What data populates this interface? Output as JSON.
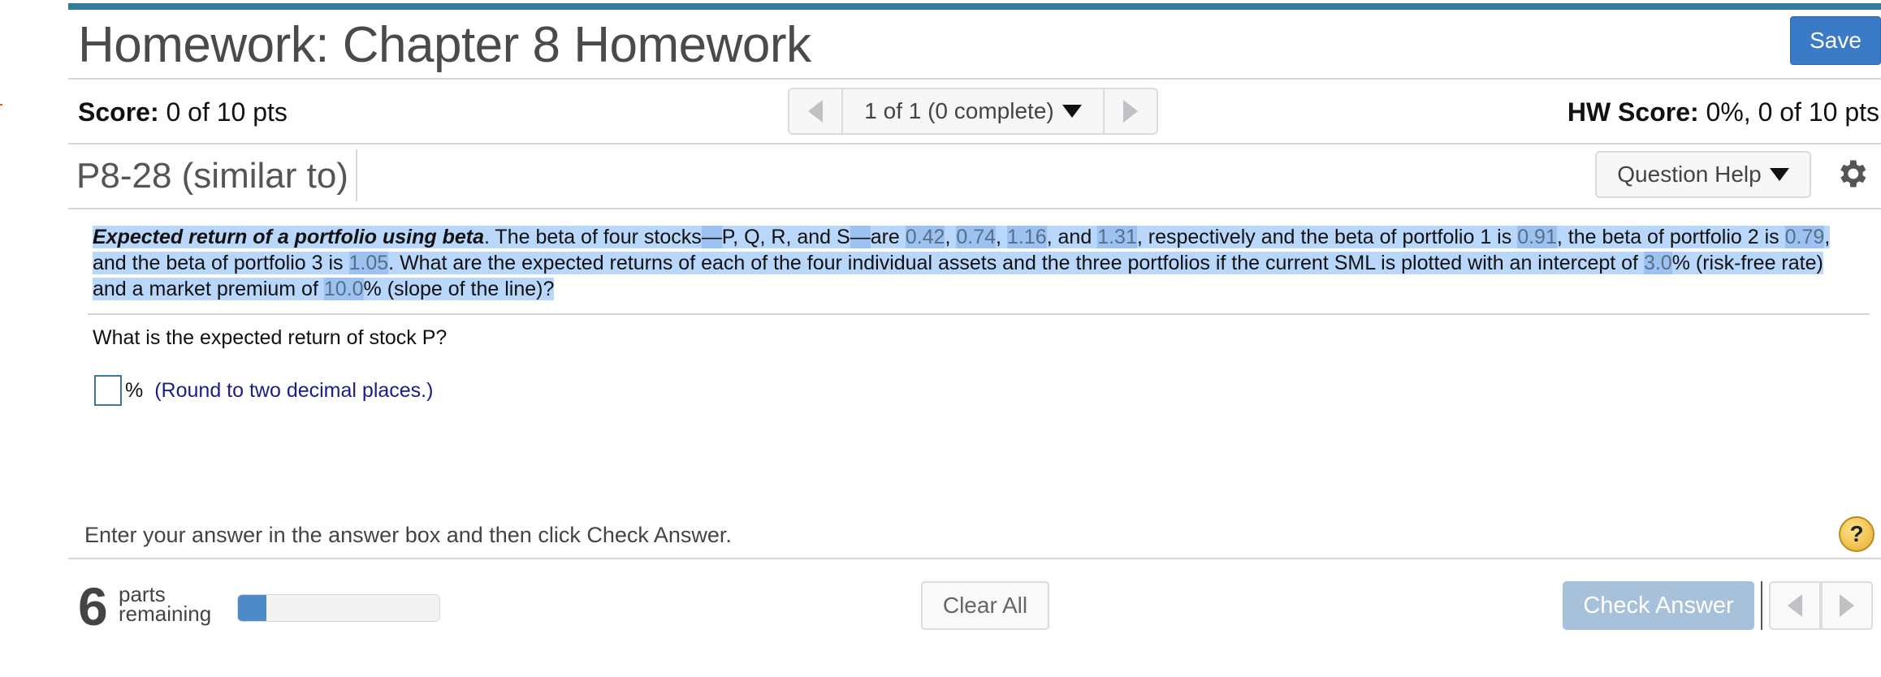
{
  "header": {
    "title": "Homework: Chapter 8 Homework",
    "save_label": "Save"
  },
  "score_bar": {
    "score_label": "Score:",
    "score_value": " 0 of 10 pts",
    "navigator_text": "1 of 1 (0 complete)",
    "hw_score_label": "HW Score:",
    "hw_score_value": " 0%, 0 of 10 pts"
  },
  "question": {
    "id": "P8-28 (similar to)",
    "help_label": "Question Help",
    "problem": {
      "title": "Expected return of a portfolio using beta",
      "stock_betas": [
        "0.42",
        "0.74",
        "1.16",
        "1.31"
      ],
      "portfolio_betas": [
        "0.91",
        "0.79",
        "1.05"
      ],
      "risk_free_rate": "3.0",
      "market_premium": "10.0",
      "text_parts": {
        "p1": ".  The beta of four stocks",
        "dash1": "—",
        "p2": "P, Q, R, and S",
        "dash2": "—",
        "p3": "are ",
        "sep_comma": ", ",
        "sep_and": ", and ",
        "p4": ", respectively and the beta of portfolio 1 is ",
        "p5": ", the beta of portfolio 2 is ",
        "p6": ", and the beta of portfolio 3 is ",
        "p7": ".  What are the expected returns of each of the four individual assets and the three portfolios if the current SML is plotted with an intercept of ",
        "p8": "% (risk-free rate) and a market premium of ",
        "p9": "% (slope of the line)?"
      }
    },
    "sub_question": "What is the expected return of stock P?",
    "answer": {
      "value": "",
      "unit": "%",
      "hint": "(Round to two decimal places.)"
    }
  },
  "footer": {
    "instruction": "Enter your answer in the answer box and then click Check Answer.",
    "help_symbol": "?",
    "parts_remaining": "6",
    "parts_label_1": "parts",
    "parts_label_2": "remaining",
    "progress_fraction": 0.14,
    "clear_all_label": "Clear All",
    "check_answer_label": "Check Answer"
  },
  "colors": {
    "accent": "#3a7bc8",
    "top_bar": "#347a9a",
    "selection": "#b9d6fb",
    "hint_text": "#1c1c8f",
    "check_disabled": "#a7c1da"
  }
}
